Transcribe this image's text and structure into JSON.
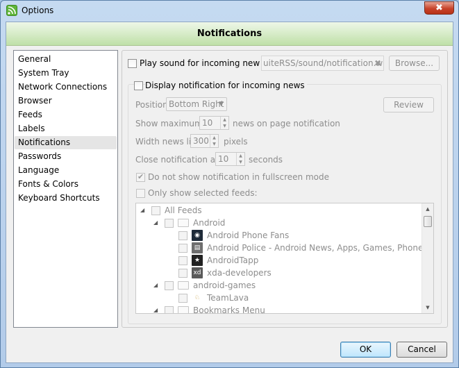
{
  "window": {
    "title": "Options",
    "close_glyph": "✖"
  },
  "header": {
    "title": "Notifications"
  },
  "nav": {
    "items": [
      {
        "label": "General"
      },
      {
        "label": "System Tray"
      },
      {
        "label": "Network Connections"
      },
      {
        "label": "Browser"
      },
      {
        "label": "Feeds"
      },
      {
        "label": "Labels"
      },
      {
        "label": "Notifications",
        "selected": true
      },
      {
        "label": "Passwords"
      },
      {
        "label": "Language"
      },
      {
        "label": "Fonts & Colors"
      },
      {
        "label": "Keyboard Shortcuts"
      }
    ]
  },
  "sound": {
    "label": "Play sound for incoming new news",
    "checked": false,
    "file_path": "uiteRSS/sound/notification.wav",
    "browse_label": "Browse..."
  },
  "display": {
    "label": "Display notification for incoming news",
    "checked": false,
    "position_label": "Position",
    "position_value": "Bottom Right",
    "review_label": "Review",
    "max_prefix": "Show maximum of",
    "max_value": "10",
    "max_suffix": "news on page notification",
    "width_prefix": "Width news list",
    "width_value": "300",
    "width_suffix": "pixels",
    "close_prefix": "Close notification after",
    "close_value": "10",
    "close_suffix": "seconds",
    "fullscreen_label": "Do not show notification in fullscreen mode",
    "fullscreen_checked": true,
    "selected_feeds_label": "Only show selected feeds:"
  },
  "tree": {
    "rows": [
      {
        "label": "All Feeds"
      },
      {
        "label": "Android"
      },
      {
        "label": "Android Phone Fans"
      },
      {
        "label": "Android Police - Android News, Apps, Games, Phones, T..."
      },
      {
        "label": "AndroidTapp"
      },
      {
        "label": "xda-developers"
      },
      {
        "label": "android-games"
      },
      {
        "label": "TeamLava"
      },
      {
        "label": "Bookmarks Menu"
      }
    ]
  },
  "footer": {
    "ok_label": "OK",
    "cancel_label": "Cancel"
  }
}
